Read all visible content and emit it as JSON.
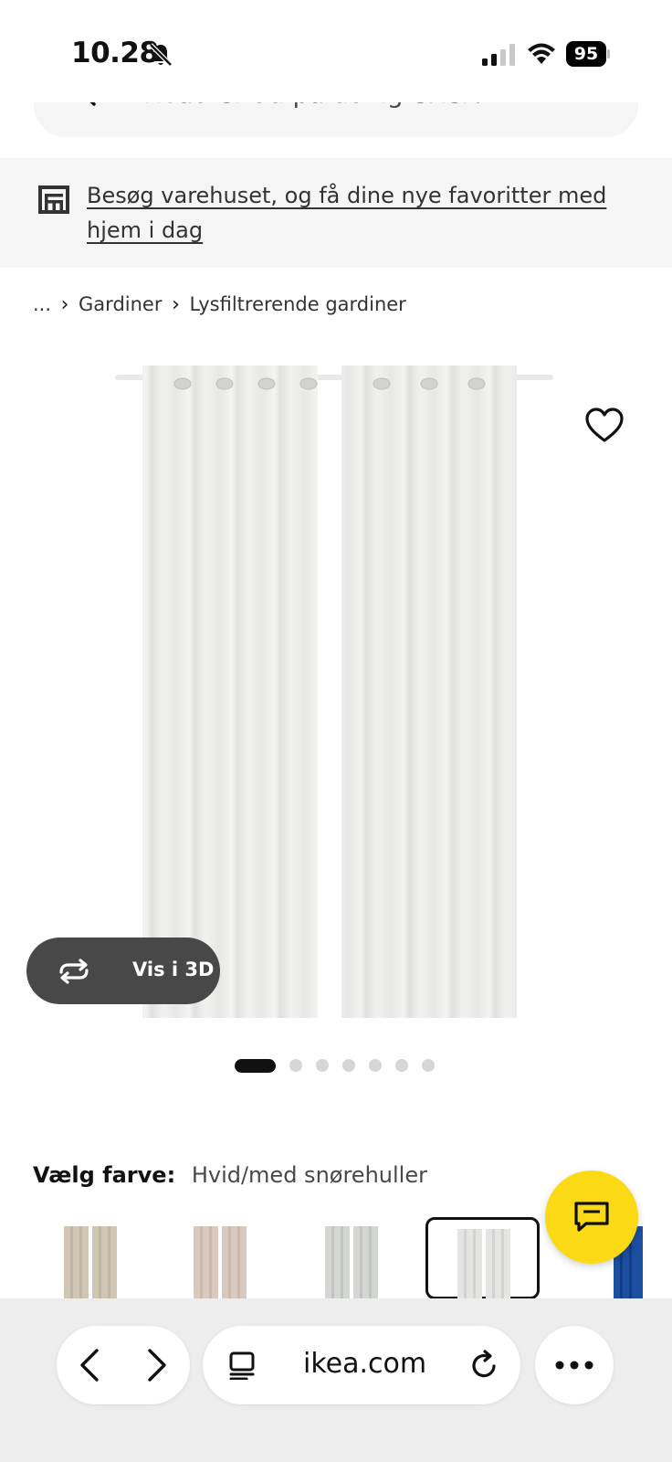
{
  "status_bar": {
    "time": "10.28",
    "battery": "95"
  },
  "search": {
    "placeholder": "Hvad er du på udkig efter?"
  },
  "store_banner": {
    "text": "Besøg varehuset, og få dine nye favoritter med hjem i dag"
  },
  "breadcrumb": {
    "ellipsis": "...",
    "items": [
      "Gardiner",
      "Lysfiltrerende gardiner"
    ]
  },
  "product": {
    "view_3d_label": "Vis i 3D",
    "image_count": 7,
    "active_image": 1
  },
  "color": {
    "label": "Vælg farve:",
    "selected": "Hvid/med snørehuller",
    "swatches": [
      {
        "tone": "#cfc6b3"
      },
      {
        "tone": "#d9c8bd"
      },
      {
        "tone": "#d4d6d3"
      },
      {
        "tone": "#e4e4e2",
        "selected": true
      },
      {
        "tone": "#1d4fa0"
      }
    ]
  },
  "chat": {
    "color": "#fbd914"
  },
  "browser": {
    "url": "ikea.com"
  }
}
